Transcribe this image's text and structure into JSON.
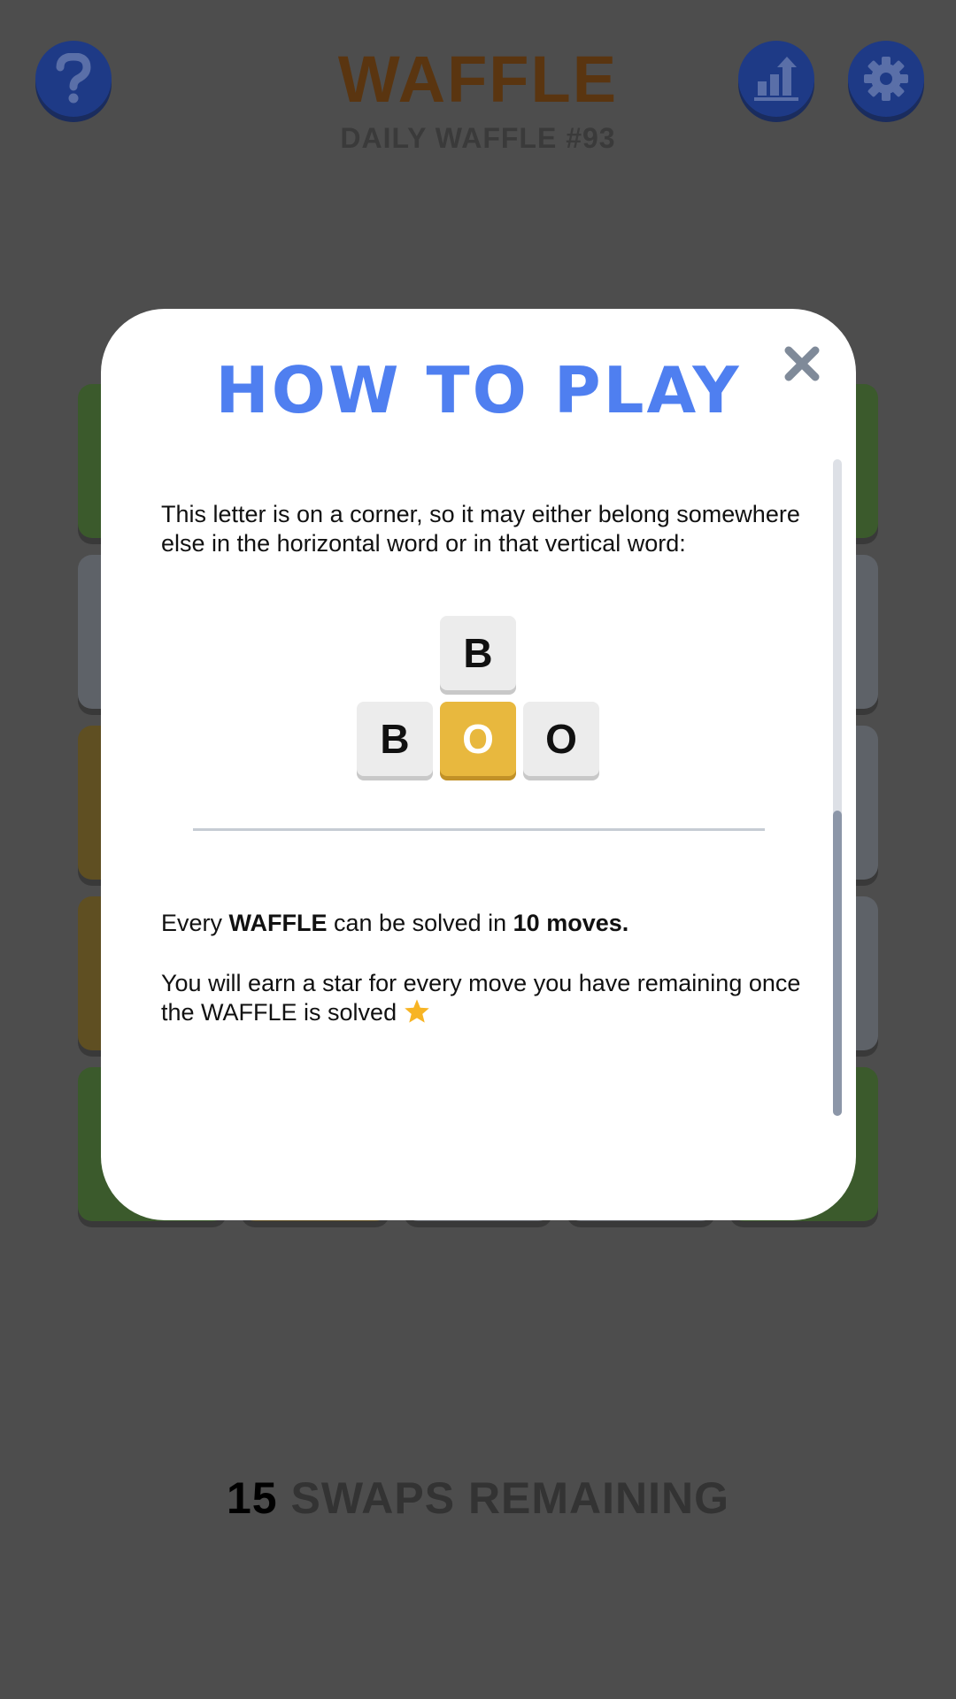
{
  "header": {
    "title": "WAFFLE",
    "subtitle": "DAILY WAFFLE #93",
    "help_icon": "question-icon",
    "stats_icon": "stats-icon",
    "settings_icon": "gear-icon"
  },
  "footer": {
    "swaps_count": "15",
    "swaps_label": "SWAPS REMAINING"
  },
  "modal": {
    "title": "HOW TO PLAY",
    "close_icon": "close-icon",
    "paragraph1": "This letter is on a corner, so it may either belong somewhere else in the horizontal word or in that vertical word:",
    "example_tiles": {
      "top": "B",
      "left": "B",
      "center": "O",
      "right": "O"
    },
    "moves": {
      "prefix": "Every ",
      "game_name": "WAFFLE",
      "middle": " can be solved in ",
      "count": "10 moves.",
      "suffix": ""
    },
    "stars_text": "You will earn a star for every move you have remaining once the WAFFLE is solved",
    "star_icon": "star-icon"
  },
  "colors": {
    "accent_blue": "#4f7ff0",
    "tile_yellow": "#e8b83e",
    "tile_grey": "#ececec"
  }
}
